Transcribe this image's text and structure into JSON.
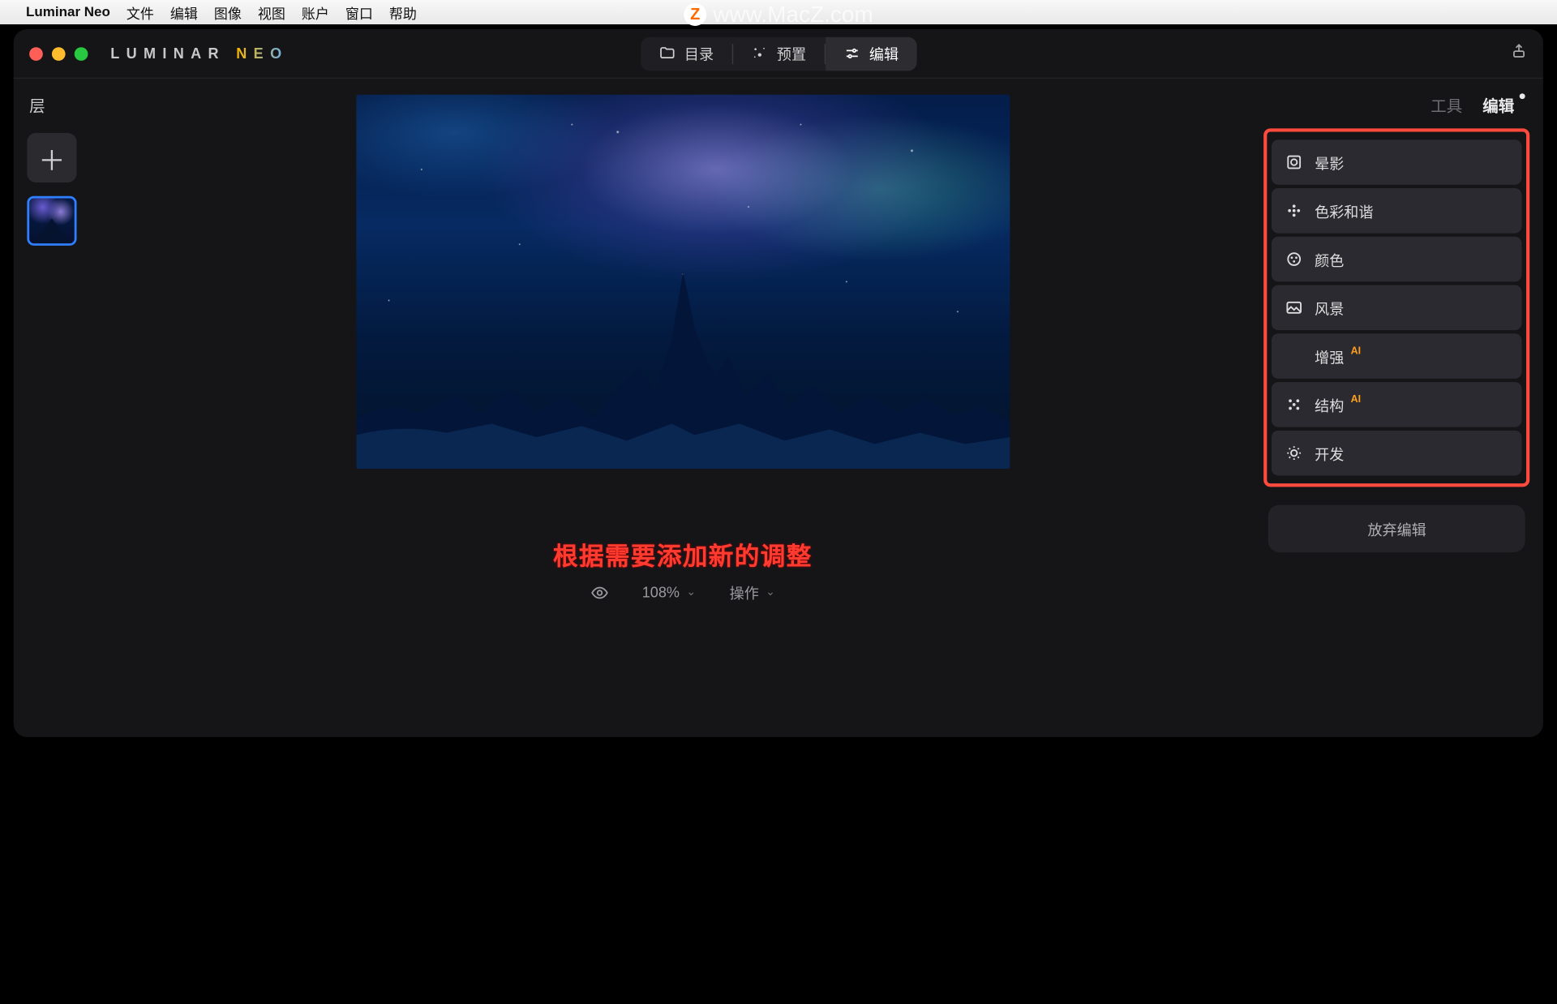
{
  "menubar": {
    "app_name": "Luminar Neo",
    "items": [
      "文件",
      "编辑",
      "图像",
      "视图",
      "账户",
      "窗口",
      "帮助"
    ]
  },
  "watermark": {
    "badge": "Z",
    "text": "www.MacZ.com"
  },
  "logo": {
    "part1": "LUMIN",
    "part2": "AR ",
    "part3": "NEO"
  },
  "top_tabs": {
    "catalog": "目录",
    "presets": "预置",
    "edit": "编辑"
  },
  "left": {
    "title": "层"
  },
  "status": {
    "zoom": "108%",
    "actions": "操作"
  },
  "caption": "根据需要添加新的调整",
  "right": {
    "tabs": {
      "tools": "工具",
      "edits": "编辑"
    },
    "tools": [
      {
        "label": "晕影",
        "ai": false
      },
      {
        "label": "色彩和谐",
        "ai": false
      },
      {
        "label": "颜色",
        "ai": false
      },
      {
        "label": "风景",
        "ai": false
      },
      {
        "label": "增强",
        "ai": true
      },
      {
        "label": "结构",
        "ai": true
      },
      {
        "label": "开发",
        "ai": false
      }
    ],
    "discard": "放弃编辑",
    "ai_badge": "AI"
  }
}
